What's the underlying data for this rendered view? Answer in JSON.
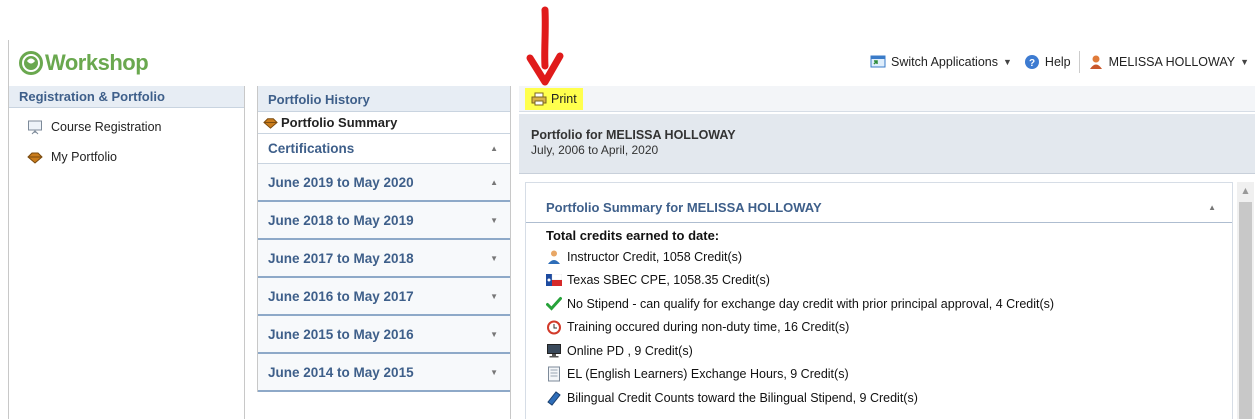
{
  "header": {
    "logo_text": "Workshop",
    "switch_apps": "Switch Applications",
    "help": "Help",
    "user": "MELISSA HOLLOWAY"
  },
  "leftnav": {
    "heading": "Registration & Portfolio",
    "items": [
      {
        "label": "Course Registration",
        "icon": "presentation-board-icon"
      },
      {
        "label": "My Portfolio",
        "icon": "portfolio-gem-icon"
      }
    ]
  },
  "middle": {
    "heading": "Portfolio History",
    "summary_label": "Portfolio Summary",
    "certifications": "Certifications",
    "years": [
      "June 2019 to May 2020",
      "June 2018 to May 2019",
      "June 2017 to May 2018",
      "June 2016 to May 2017",
      "June 2015 to May 2016",
      "June 2014 to May 2015"
    ]
  },
  "right": {
    "print": "Print",
    "portfolio_title": "Portfolio for MELISSA HOLLOWAY",
    "portfolio_range": "July, 2006 to April, 2020",
    "summary_title": "Portfolio Summary for MELISSA HOLLOWAY",
    "total_label": "Total credits earned to date:",
    "credits": [
      {
        "text": "Instructor Credit, 1058 Credit(s)",
        "icon": "instructor-person-icon"
      },
      {
        "text": "Texas SBEC CPE, 1058.35 Credit(s)",
        "icon": "texas-flag-icon"
      },
      {
        "text": "No Stipend - can qualify for exchange day credit with prior principal approval, 4 Credit(s)",
        "icon": "green-check-icon"
      },
      {
        "text": "Training occured during non-duty time, 16 Credit(s)",
        "icon": "alarm-clock-icon"
      },
      {
        "text": "Online PD , 9 Credit(s)",
        "icon": "computer-monitor-icon"
      },
      {
        "text": "EL (English Learners) Exchange Hours, 9 Credit(s)",
        "icon": "document-icon"
      },
      {
        "text": "Bilingual Credit Counts toward the Bilingual Stipend, 9 Credit(s)",
        "icon": "blue-book-icon"
      }
    ]
  },
  "colors": {
    "accent": "#3e5f8a",
    "logo": "#6aa84f",
    "highlight": "#ffff4d",
    "arrow": "#e01b1b"
  }
}
